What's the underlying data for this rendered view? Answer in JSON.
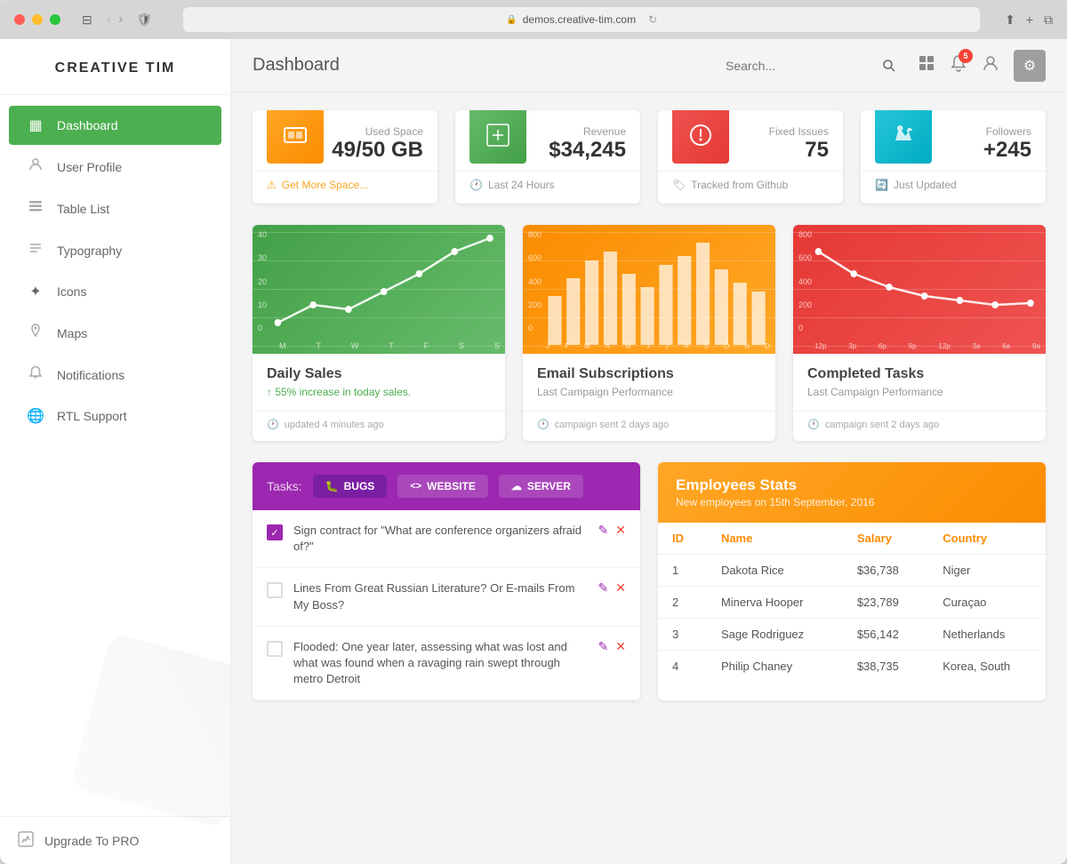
{
  "browser": {
    "url": "demos.creative-tim.com"
  },
  "sidebar": {
    "logo": "CREATIVE TIM",
    "nav_items": [
      {
        "id": "dashboard",
        "label": "Dashboard",
        "icon": "▦",
        "active": true
      },
      {
        "id": "user-profile",
        "label": "User Profile",
        "icon": "👤",
        "active": false
      },
      {
        "id": "table-list",
        "label": "Table List",
        "icon": "📋",
        "active": false
      },
      {
        "id": "typography",
        "label": "Typography",
        "icon": "☰",
        "active": false
      },
      {
        "id": "icons",
        "label": "Icons",
        "icon": "✦",
        "active": false
      },
      {
        "id": "maps",
        "label": "Maps",
        "icon": "📍",
        "active": false
      },
      {
        "id": "notifications",
        "label": "Notifications",
        "icon": "🔔",
        "active": false
      },
      {
        "id": "rtl-support",
        "label": "RTL Support",
        "icon": "🌐",
        "active": false
      }
    ],
    "bottom_item": {
      "icon": "⬆",
      "label": "Upgrade To PRO"
    }
  },
  "topbar": {
    "title": "Dashboard",
    "search_placeholder": "Search...",
    "notification_count": "5"
  },
  "stats": [
    {
      "id": "used-space",
      "label": "Used Space",
      "value": "49/50 GB",
      "color_class": "icon-orange",
      "icon": "▣",
      "footer": "Get More Space...",
      "footer_type": "link",
      "footer_icon": "⚠"
    },
    {
      "id": "revenue",
      "label": "Revenue",
      "value": "$34,245",
      "color_class": "icon-green",
      "icon": "🏪",
      "footer": "Last 24 Hours",
      "footer_type": "text",
      "footer_icon": "🕐"
    },
    {
      "id": "fixed-issues",
      "label": "Fixed Issues",
      "value": "75",
      "color_class": "icon-red",
      "icon": "ℹ",
      "footer": "Tracked from Github",
      "footer_type": "text",
      "footer_icon": "🏷"
    },
    {
      "id": "followers",
      "label": "Followers",
      "value": "+245",
      "color_class": "icon-teal",
      "icon": "🐦",
      "footer": "Just Updated",
      "footer_type": "text",
      "footer_icon": "🔄"
    }
  ],
  "charts": [
    {
      "id": "daily-sales",
      "title": "Daily Sales",
      "subtitle": "↑ 55% increase in today sales.",
      "subtitle_color": "green",
      "footer": "updated 4 minutes ago",
      "color": "green",
      "x_labels": [
        "M",
        "T",
        "W",
        "T",
        "F",
        "S",
        "S"
      ],
      "y_labels": [
        "40",
        "30",
        "20",
        "10",
        "0"
      ]
    },
    {
      "id": "email-subscriptions",
      "title": "Email Subscriptions",
      "subtitle": "Last Campaign Performance",
      "subtitle_color": "gray",
      "footer": "campaign sent 2 days ago",
      "color": "orange",
      "x_labels": [
        "J",
        "F",
        "M",
        "A",
        "M",
        "J",
        "J",
        "A",
        "S",
        "O",
        "N",
        "D"
      ],
      "y_labels": [
        "800",
        "600",
        "400",
        "200",
        "0"
      ]
    },
    {
      "id": "completed-tasks",
      "title": "Completed Tasks",
      "subtitle": "Last Campaign Performance",
      "subtitle_color": "gray",
      "footer": "campaign sent 2 days ago",
      "color": "red",
      "x_labels": [
        "12p",
        "3p",
        "6p",
        "9p",
        "12p",
        "3a",
        "6a",
        "9a"
      ],
      "y_labels": [
        "800",
        "600",
        "400",
        "200",
        "0"
      ]
    }
  ],
  "tasks": {
    "header_label": "Tasks:",
    "tabs": [
      {
        "id": "bugs",
        "label": "BUGS",
        "icon": "🐛",
        "active": true
      },
      {
        "id": "website",
        "label": "WEBSITE",
        "icon": "<>",
        "active": false
      },
      {
        "id": "server",
        "label": "SERVER",
        "icon": "☁",
        "active": false
      }
    ],
    "items": [
      {
        "id": "task-1",
        "text": "Sign contract for \"What are conference organizers afraid of?\"",
        "checked": true
      },
      {
        "id": "task-2",
        "text": "Lines From Great Russian Literature? Or E-mails From My Boss?",
        "checked": false
      },
      {
        "id": "task-3",
        "text": "Flooded: One year later, assessing what was lost and what was found when a ravaging rain swept through metro Detroit",
        "checked": false
      }
    ]
  },
  "employees": {
    "title": "Employees Stats",
    "subtitle": "New employees on 15th September, 2016",
    "columns": [
      "ID",
      "Name",
      "Salary",
      "Country"
    ],
    "rows": [
      {
        "id": "1",
        "name": "Dakota Rice",
        "salary": "$36,738",
        "country": "Niger"
      },
      {
        "id": "2",
        "name": "Minerva Hooper",
        "salary": "$23,789",
        "country": "Curaçao"
      },
      {
        "id": "3",
        "name": "Sage Rodriguez",
        "salary": "$56,142",
        "country": "Netherlands"
      },
      {
        "id": "4",
        "name": "Philip Chaney",
        "salary": "$38,735",
        "country": "Korea, South"
      }
    ]
  }
}
